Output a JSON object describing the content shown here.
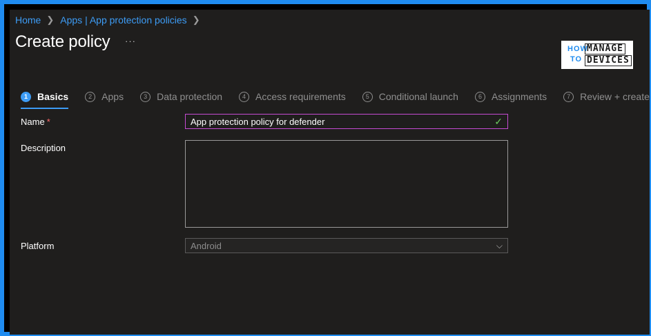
{
  "breadcrumb": {
    "home": "Home",
    "apps": "Apps | App protection policies"
  },
  "page": {
    "title": "Create policy",
    "more_label": "···"
  },
  "logo": {
    "how": "HOW",
    "to": "TO",
    "manage": "MANAGE",
    "devices": "DEVICES"
  },
  "steps": [
    {
      "num": "1",
      "label": "Basics"
    },
    {
      "num": "2",
      "label": "Apps"
    },
    {
      "num": "3",
      "label": "Data protection"
    },
    {
      "num": "4",
      "label": "Access requirements"
    },
    {
      "num": "5",
      "label": "Conditional launch"
    },
    {
      "num": "6",
      "label": "Assignments"
    },
    {
      "num": "7",
      "label": "Review + create"
    }
  ],
  "form": {
    "name_label": "Name",
    "required_mark": "*",
    "name_value": "App protection policy for defender",
    "description_label": "Description",
    "description_value": "",
    "platform_label": "Platform",
    "platform_value": "Android"
  },
  "colors": {
    "accent": "#3d9cf5",
    "frame": "#1f8cf0",
    "focus_border": "#c74bd4",
    "valid": "#6ccb5f"
  }
}
